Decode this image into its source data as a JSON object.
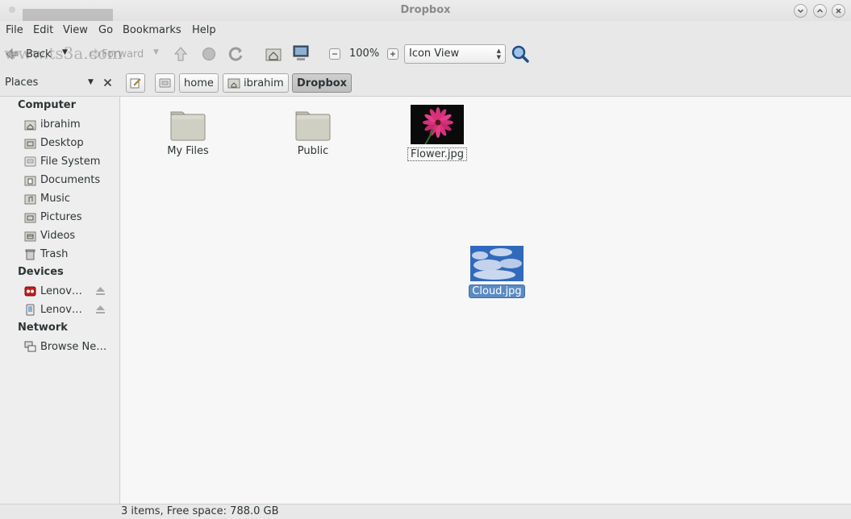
{
  "window": {
    "title": "Dropbox"
  },
  "menu": [
    "File",
    "Edit",
    "View",
    "Go",
    "Bookmarks",
    "Help"
  ],
  "toolbar": {
    "back_label": "Back",
    "forward_label": "Forward",
    "zoom_value": "100%",
    "view_mode": "Icon View"
  },
  "watermark": "www.ts3a.com",
  "places": {
    "header": "Places",
    "computer_heading": "Computer",
    "computer_items": [
      "ibrahim",
      "Desktop",
      "File System",
      "Documents",
      "Music",
      "Pictures",
      "Videos",
      "Trash"
    ],
    "devices_heading": "Devices",
    "device_items": [
      "Lenov…",
      "Lenov…"
    ],
    "network_heading": "Network",
    "network_items": [
      "Browse Ne…"
    ]
  },
  "breadcrumb": [
    "home",
    "ibrahim",
    "Dropbox"
  ],
  "files": [
    {
      "name": "My Files",
      "type": "folder"
    },
    {
      "name": "Public",
      "type": "folder"
    },
    {
      "name": "Flower.jpg",
      "type": "image-flower"
    },
    {
      "name": "Cloud.jpg",
      "type": "image-cloud"
    }
  ],
  "status": "3 items, Free space: 788.0 GB"
}
